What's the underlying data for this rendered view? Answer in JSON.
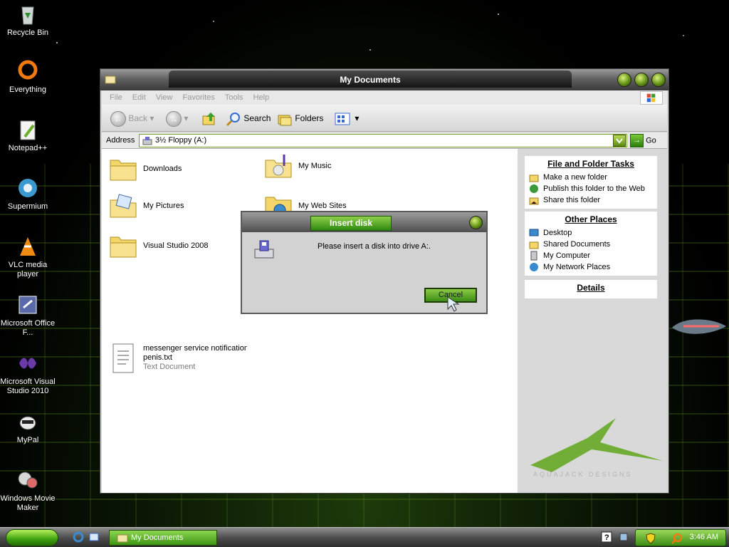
{
  "desktop": {
    "icons": [
      {
        "label": "Recycle Bin",
        "icon": "recycle-bin-icon"
      },
      {
        "label": "Everything",
        "icon": "everything-icon"
      },
      {
        "label": "Notepad++",
        "icon": "notepadpp-icon"
      },
      {
        "label": "Supermium",
        "icon": "supermium-icon"
      },
      {
        "label": "VLC media player",
        "icon": "vlc-icon"
      },
      {
        "label": "Microsoft Office F...",
        "icon": "office-icon"
      },
      {
        "label": "Microsoft Visual Studio 2010",
        "icon": "visual-studio-icon"
      },
      {
        "label": "MyPal",
        "icon": "mypal-icon"
      },
      {
        "label": "Windows Movie Maker",
        "icon": "movie-maker-icon"
      }
    ]
  },
  "window": {
    "title": "My Documents",
    "menu": [
      "File",
      "Edit",
      "View",
      "Favorites",
      "Tools",
      "Help"
    ],
    "toolbar": {
      "back": "Back",
      "search": "Search",
      "folders": "Folders"
    },
    "address": {
      "label": "Address",
      "value": "3½ Floppy (A:)",
      "go": "Go"
    },
    "items": [
      {
        "label": "Downloads",
        "type": "folder"
      },
      {
        "label": "My Music",
        "type": "music-folder"
      },
      {
        "label": "My Pictures",
        "type": "pictures-folder"
      },
      {
        "label": "My Web Sites",
        "type": "web-folder"
      },
      {
        "label": "Visual Studio 2008",
        "type": "folder"
      },
      {
        "label": "messenger service notification",
        "label2": "penis.txt",
        "sub": "Text Document",
        "type": "text-file"
      }
    ],
    "side": {
      "file_tasks": {
        "title": "File and Folder Tasks",
        "items": [
          "Make a new folder",
          "Publish this folder to the Web",
          "Share this folder"
        ]
      },
      "other_places": {
        "title": "Other Places",
        "items": [
          "Desktop",
          "Shared Documents",
          "My Computer",
          "My Network Places"
        ]
      },
      "details": {
        "title": "Details"
      },
      "brand": "AQUAJACK DESIGNS"
    }
  },
  "dialog": {
    "title": "Insert disk",
    "message": "Please insert a disk into drive A:.",
    "cancel": "Cancel"
  },
  "taskbar": {
    "task": "My Documents",
    "clock": "3:46 AM"
  },
  "colors": {
    "accent": "#5a9e1a",
    "window_bg": "#d4d4d4",
    "title_dark": "#141414"
  }
}
